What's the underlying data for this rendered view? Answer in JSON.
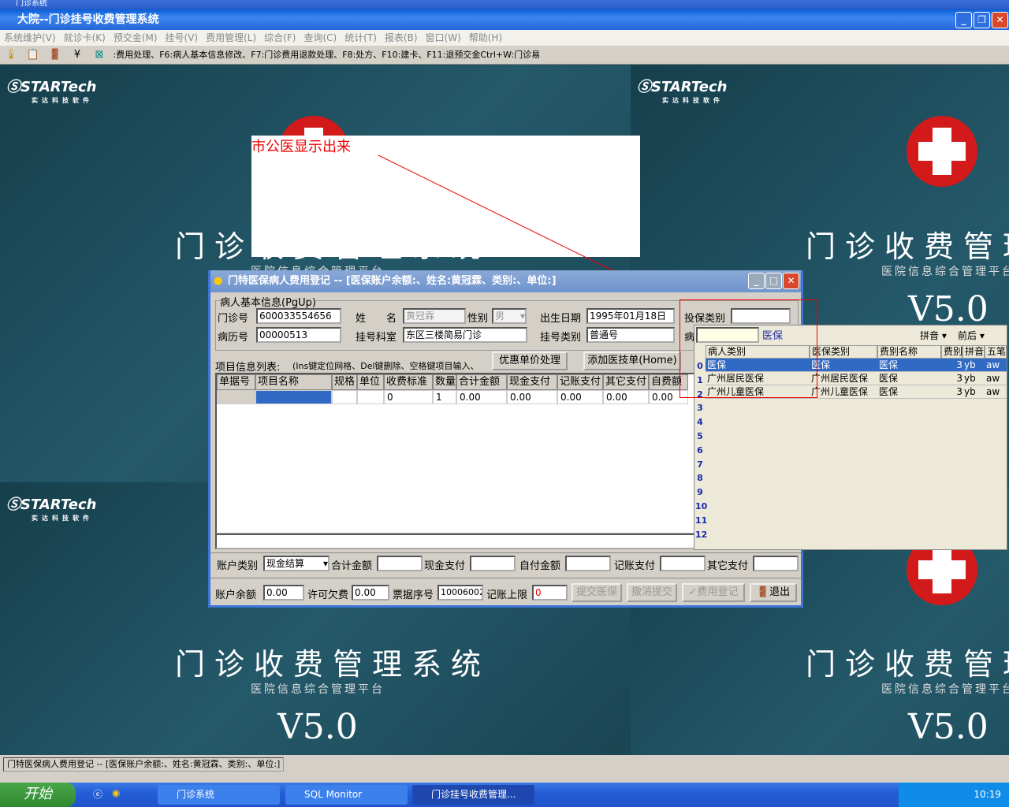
{
  "app": {
    "behind_title": "门诊系统",
    "title": "大院--门诊挂号收费管理系统"
  },
  "menu": [
    "系统维护(V)",
    "就诊卡(K)",
    "预交金(M)",
    "挂号(V)",
    "费用管理(L)",
    "综合(F)",
    "查询(C)",
    "统计(T)",
    "报表(B)",
    "窗口(W)",
    "帮助(H)"
  ],
  "toolbar": {
    "hint": ":费用处理、F6:病人基本信息修改、F7:门诊费用退款处理、F8:处方、F10:建卡、F11:退预交金Ctrl+W:门诊易"
  },
  "background": {
    "logo": "STARTech",
    "logo_sub": "实达科技软件",
    "title": "门诊收费管理系统",
    "subtitle": "医院信息综合管理平台",
    "version": "V5.0"
  },
  "annotation": {
    "text": "市公医显示出来",
    "color": "#ff0000"
  },
  "dialog": {
    "title": "门特医保病人费用登记 -- [医保账户余额:、姓名:黄冠霖、类别:、单位:]",
    "group": "病人基本信息(PgUp)",
    "fields": {
      "clinic_no": {
        "label": "门诊号",
        "value": "600033554656"
      },
      "name": {
        "label": "姓　　名",
        "value": "黄冠霖"
      },
      "sex": {
        "label": "性别",
        "value": "男"
      },
      "birth": {
        "label": "出生日期",
        "value": "1995年01月18日"
      },
      "insure_type": {
        "label": "投保类别",
        "value": ""
      },
      "record_no": {
        "label": "病历号",
        "value": "00000513"
      },
      "dept": {
        "label": "挂号科室",
        "value": "东区三楼简易门诊"
      },
      "reg_type": {
        "label": "挂号类别",
        "value": "普通号"
      },
      "patient_type": {
        "label": "病",
        "value": ""
      }
    },
    "list_label": "项目信息列表:",
    "list_hint": "(Ins键定位网格、Del键删除、空格键项目输入、",
    "discount_button": "优惠单价处理",
    "add_tech_button": "添加医技单(Home)",
    "columns": [
      "单据号",
      "项目名称",
      "规格",
      "单位",
      "收费标准",
      "数量",
      "合计金额",
      "现金支付",
      "记账支付",
      "其它支付",
      "自费额"
    ],
    "row": [
      "",
      "",
      "",
      "",
      "0",
      "1",
      "0.00",
      "0.00",
      "0.00",
      "0.00",
      "0.00"
    ],
    "account_type": {
      "label": "账户类别",
      "value": "现金结算"
    },
    "total": {
      "label": "合计金额",
      "value": ""
    },
    "cash": {
      "label": "现金支付",
      "value": ""
    },
    "self": {
      "label": "自付金额",
      "value": ""
    },
    "charge": {
      "label": "记账支付",
      "value": ""
    },
    "other": {
      "label": "其它支付",
      "value": ""
    },
    "balance": {
      "label": "账户余额",
      "value": "0.00"
    },
    "allow_owe": {
      "label": "许可欠费",
      "value": "0.00"
    },
    "receipt": {
      "label": "票据序号",
      "value": "10006002"
    },
    "limit": {
      "label": "记账上限",
      "value": "0"
    },
    "buttons": {
      "submit": "提交医保",
      "cancel": "撤消提交",
      "register": "费用登记",
      "exit": "退出"
    }
  },
  "dropdown": {
    "search_value": "",
    "selected_text": "医保",
    "pinyin": "拼音",
    "order": "前后",
    "columns": [
      "病人类别",
      "医保类别",
      "费别名称",
      "费别",
      "拼音",
      "五笔"
    ],
    "rows": [
      [
        "医保",
        "医保",
        "医保",
        "3",
        "yb",
        "aw"
      ],
      [
        "广州居民医保",
        "广州居民医保",
        "医保",
        "3",
        "yb",
        "aw"
      ],
      [
        "广州儿童医保",
        "广州儿童医保",
        "医保",
        "3",
        "yb",
        "aw"
      ]
    ],
    "row_numbers": [
      "0",
      "1",
      "2",
      "3",
      "4",
      "5",
      "6",
      "7",
      "8",
      "9",
      "10",
      "11",
      "12"
    ]
  },
  "statusbar": {
    "text": "门特医保病人费用登记 -- [医保账户余额:、姓名:黄冠霖、类别:、单位:]"
  },
  "taskbar": {
    "start": "开始",
    "tasks": [
      "门诊系统",
      "SQL Monitor",
      "门诊挂号收费管理..."
    ],
    "clock": "10:19"
  }
}
